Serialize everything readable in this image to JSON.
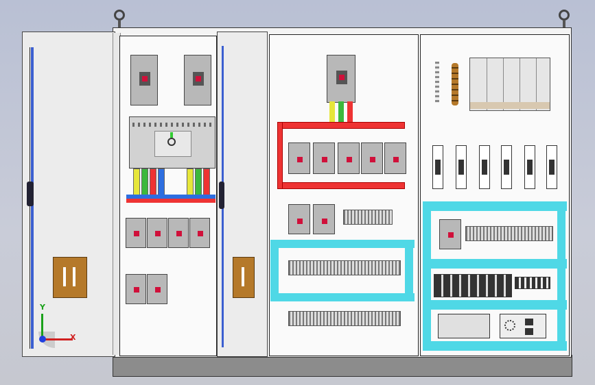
{
  "axes": {
    "x_label": "X",
    "y_label": "Y"
  },
  "colors": {
    "busbar_red": "#e33333",
    "busbar_yellow": "#e6e63a",
    "busbar_green": "#3cb83c",
    "busbar_blue": "#2d6ee0",
    "cyan_trunking": "#4fd8e6",
    "breaker_grey": "#b8b8b8",
    "handle_brown": "#b5792a"
  },
  "icons": {
    "axis_triad": "xyz-triad-icon",
    "lifting_eye": "lifting-eye-icon",
    "door_handle": "door-handle-icon"
  }
}
